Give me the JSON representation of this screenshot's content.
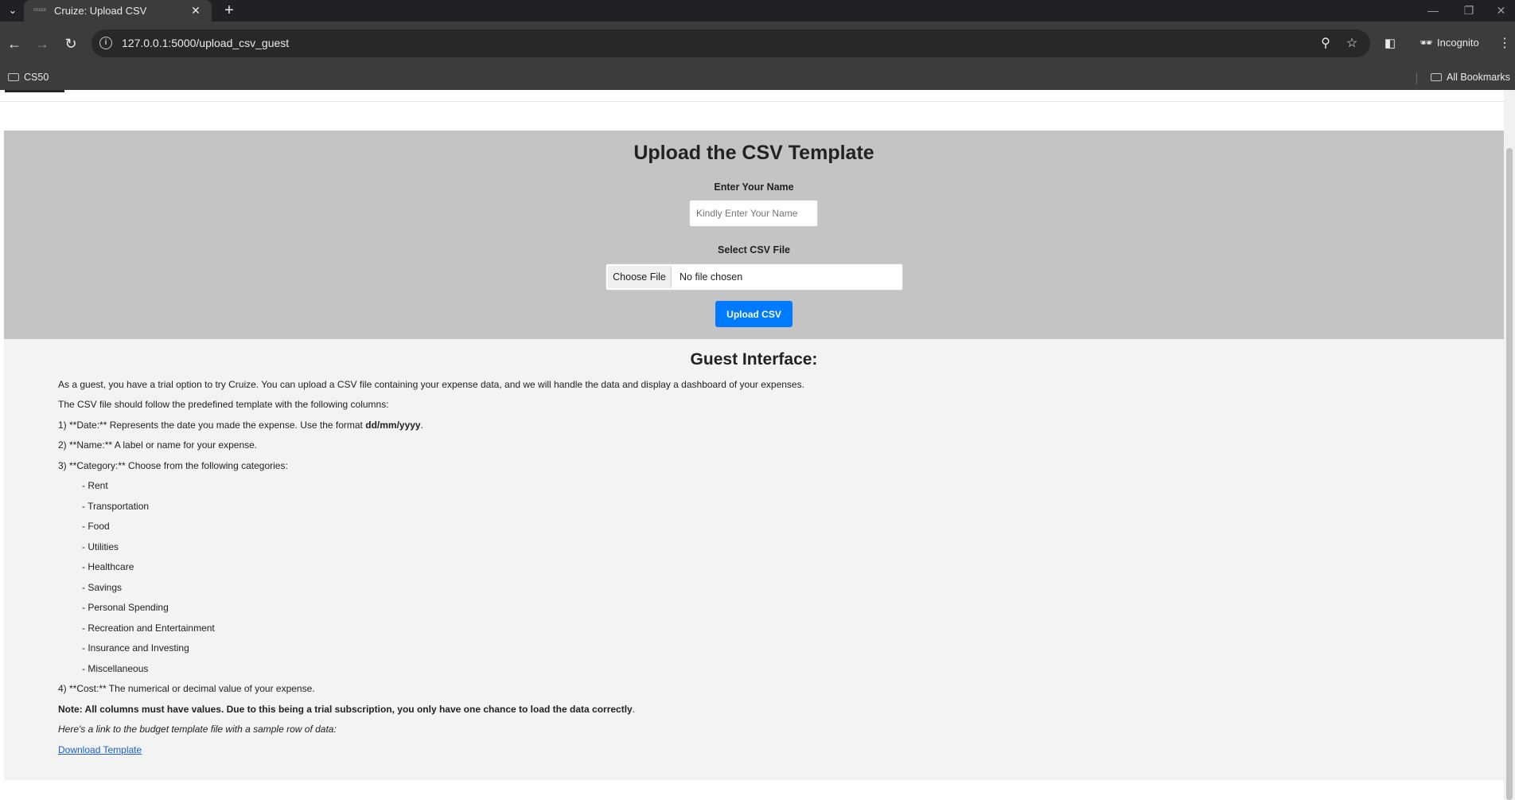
{
  "browser": {
    "tab_title": "Cruize: Upload CSV",
    "tab_favicon": "cruize",
    "url": "127.0.0.1:5000/upload_csv_guest",
    "incognito_label": "Incognito",
    "bookmarks": [
      "CS50"
    ],
    "all_bookmarks_label": "All Bookmarks"
  },
  "upload": {
    "heading": "Upload the CSV Template",
    "name_label": "Enter Your Name",
    "name_placeholder": "Kindly Enter Your Name",
    "file_label": "Select CSV File",
    "file_button": "Choose File",
    "file_status": "No file chosen",
    "submit_label": "Upload CSV"
  },
  "guest": {
    "heading": "Guest Interface:",
    "intro": "As a guest, you have a trial option to try Cruize. You can upload a CSV file containing your expense data, and we will handle the data and display a dashboard of your expenses.",
    "template_intro": "The CSV file should follow the predefined template with the following columns:",
    "date_prefix": "1) **Date:** Represents the date you made the expense. Use the format ",
    "date_format": "dd/mm/yyyy",
    "date_suffix": ".",
    "name_line": "2) **Name:** A label or name for your expense.",
    "category_line": "3) **Category:** Choose from the following categories:",
    "categories": [
      "- Rent",
      "- Transportation",
      "- Food",
      "- Utilities",
      "- Healthcare",
      "- Savings",
      "- Personal Spending",
      "- Recreation and Entertainment",
      "- Insurance and Investing",
      "- Miscellaneous"
    ],
    "cost_line": "4) **Cost:** The numerical or decimal value of your expense.",
    "note_bold": "Note: All columns must have values. Due to this being a trial subscription, you only have one chance to load the data correctly",
    "note_suffix": ".",
    "template_link_intro": "Here's a link to the budget template file with a sample row of data:",
    "download_label": "Download Template"
  },
  "colors": {
    "upload_bg": "#c4c4c4",
    "info_bg": "#f3f3f3",
    "primary_button": "#007bff",
    "link": "#1a5fd0"
  }
}
